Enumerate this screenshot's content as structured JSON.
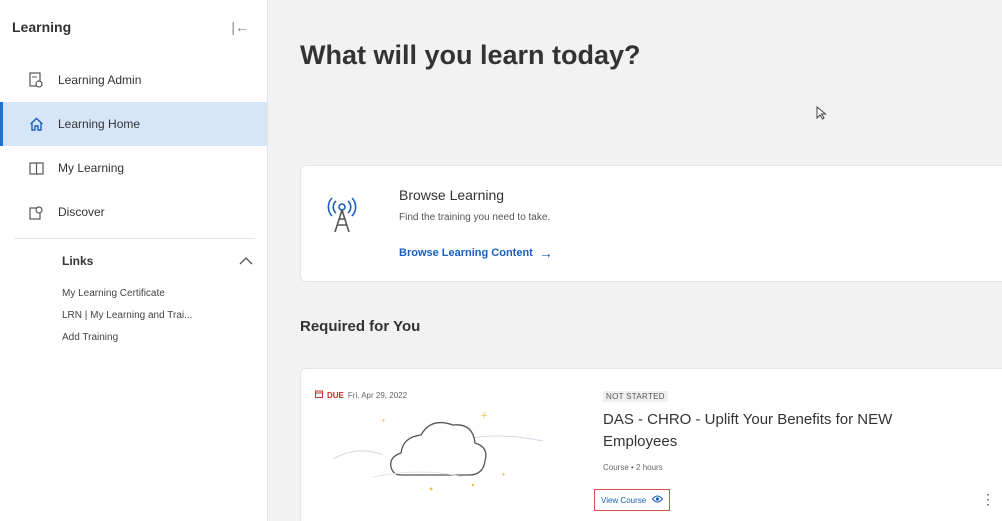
{
  "sidebar": {
    "title": "Learning",
    "collapse_icon": "collapse-left-icon",
    "items": [
      {
        "label": "Learning Admin",
        "icon": "admin-doc-icon"
      },
      {
        "label": "Learning Home",
        "icon": "home-icon",
        "active": true
      },
      {
        "label": "My Learning",
        "icon": "book-icon"
      },
      {
        "label": "Discover",
        "icon": "discover-icon"
      }
    ],
    "links": {
      "title": "Links",
      "items": [
        "My Learning Certificate",
        "LRN | My Learning and Trai...",
        "Add Training"
      ]
    }
  },
  "main": {
    "title": "What will you learn today?",
    "browse": {
      "title": "Browse Learning",
      "subtitle": "Find the training you need to take.",
      "link": "Browse Learning Content",
      "link_arrow": "→"
    },
    "required_title": "Required for You",
    "course": {
      "due_label": "DUE",
      "due_date": "Fri, Apr 29, 2022",
      "status": "NOT STARTED",
      "title": "DAS - CHRO - Uplift Your Benefits for NEW Employees",
      "meta": "Course • 2 hours",
      "view_label": "View Course"
    }
  },
  "colors": {
    "accent": "#1a73d9",
    "active_bg": "#d5e6f9",
    "due_red": "#c4322b",
    "link_blue": "#1a5fbf"
  }
}
